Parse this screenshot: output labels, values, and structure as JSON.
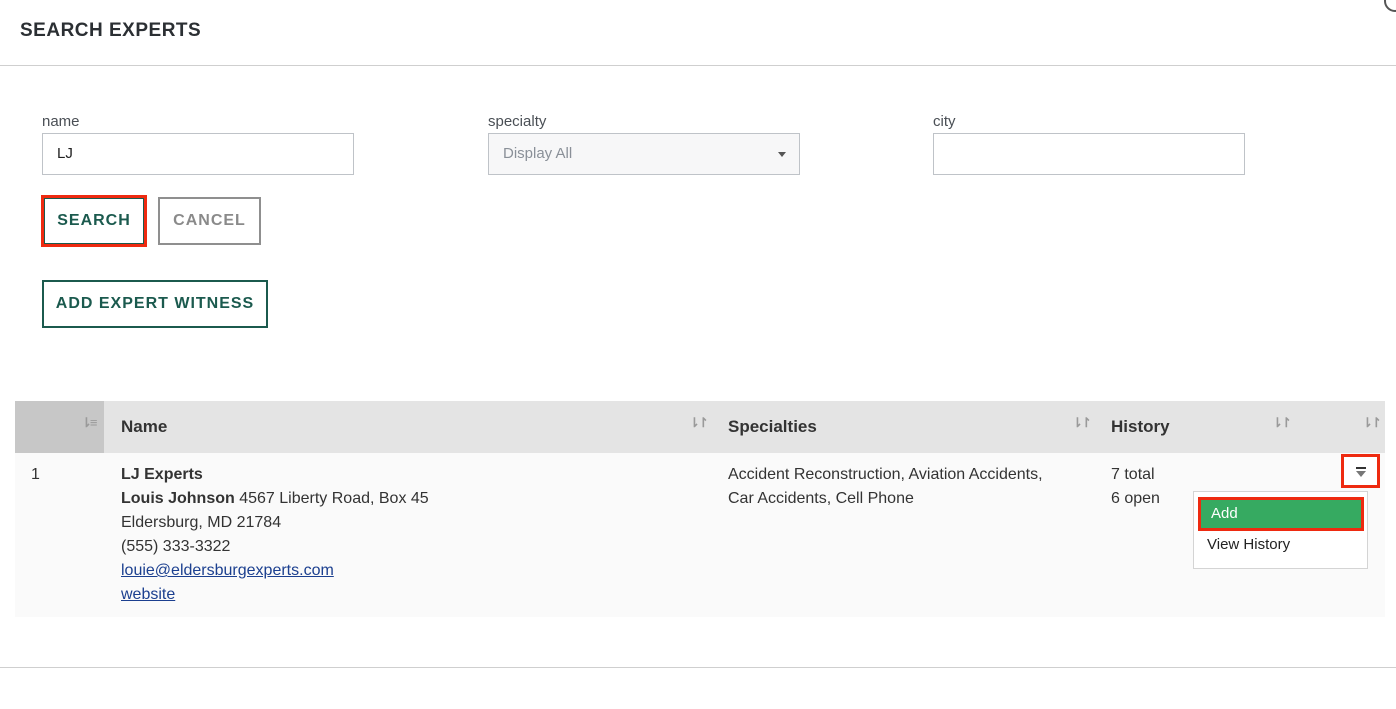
{
  "modal": {
    "title": "SEARCH EXPERTS"
  },
  "form": {
    "name_label": "name",
    "name_value": "LJ",
    "specialty_label": "specialty",
    "specialty_value": "Display All",
    "city_label": "city",
    "city_value": ""
  },
  "buttons": {
    "search": "SEARCH",
    "cancel": "CANCEL",
    "add_expert": "ADD EXPERT WITNESS"
  },
  "table": {
    "headers": {
      "name": "Name",
      "specialties": "Specialties",
      "history": "History"
    },
    "sort_icon": "⇂↾",
    "rows": [
      {
        "index": "1",
        "company": "LJ Experts",
        "contact_name": "Louis Johnson",
        "address_line1": "4567 Liberty Road, Box 45",
        "address_line2": "Eldersburg, MD 21784",
        "phone": "(555) 333-3322",
        "email": "louie@eldersburgexperts.com",
        "website": "website",
        "specialties_line1": "Accident Reconstruction, Aviation Accidents,",
        "specialties_line2": "Car Accidents, Cell Phone",
        "history_total": "7 total",
        "history_open": "6 open"
      }
    ]
  },
  "row_menu": {
    "add": "Add",
    "view_history": "View History"
  },
  "colors": {
    "brand": "#1b5a4e",
    "highlight": "#ee2a10",
    "menu_active": "#36aa61"
  }
}
